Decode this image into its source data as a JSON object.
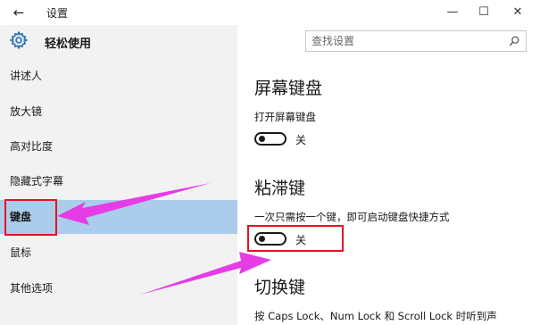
{
  "window": {
    "back_glyph": "←",
    "title": "设置",
    "minimize_glyph": "—",
    "maximize_glyph": "☐",
    "close_glyph": "✕"
  },
  "header": {
    "icon": "gear-icon",
    "title": "轻松使用"
  },
  "search": {
    "placeholder": "查找设置",
    "icon": "search-icon"
  },
  "sidebar": {
    "items": [
      {
        "label": "讲述人",
        "selected": false
      },
      {
        "label": "放大镜",
        "selected": false
      },
      {
        "label": "高对比度",
        "selected": false
      },
      {
        "label": "隐藏式字幕",
        "selected": false
      },
      {
        "label": "键盘",
        "selected": true
      },
      {
        "label": "鼠标",
        "selected": false
      },
      {
        "label": "其他选项",
        "selected": false
      }
    ]
  },
  "main": {
    "onscreen_keyboard": {
      "title": "屏幕键盘",
      "description": "打开屏幕键盘",
      "toggle_state": "关"
    },
    "sticky_keys": {
      "title": "粘滞键",
      "description": "一次只需按一个键，即可启动键盘快捷方式",
      "toggle_state": "关"
    },
    "toggle_keys": {
      "title": "切换键",
      "description": "按 Caps Lock、Num Lock 和 Scroll Lock 时听到声"
    }
  },
  "colors": {
    "selected_bg": "#a9cdea",
    "sidebar_bg": "#f2f2f2",
    "annotation_red": "#e81123",
    "annotation_arrow": "#e63ce6"
  }
}
